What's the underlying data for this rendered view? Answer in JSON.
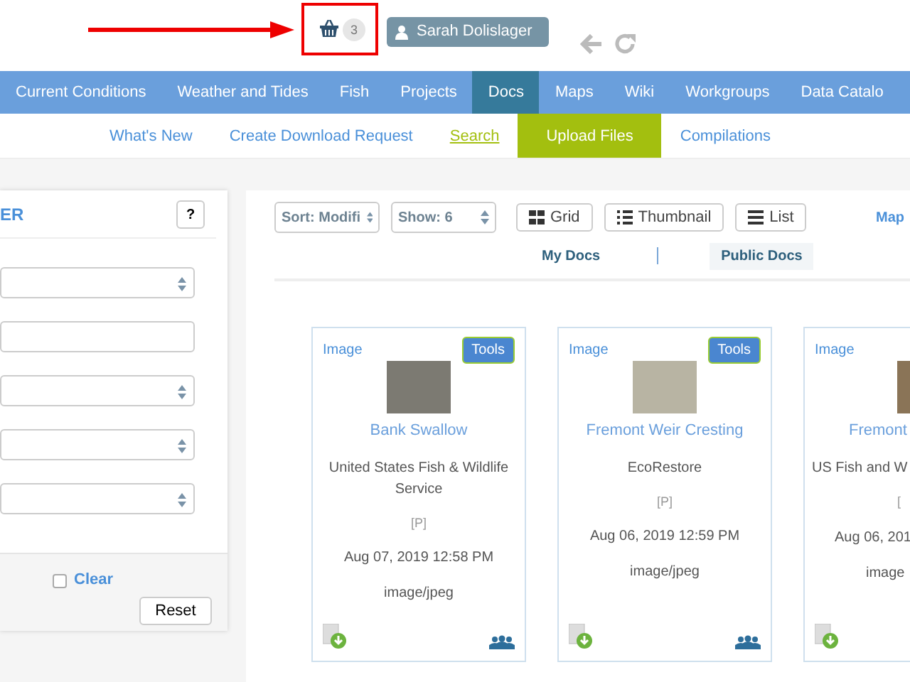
{
  "header": {
    "cart_count": "3",
    "user_name": "Sarah Dolislager"
  },
  "nav": [
    {
      "label": "Current Conditions",
      "selected": false
    },
    {
      "label": "Weather and Tides",
      "selected": false
    },
    {
      "label": "Fish",
      "selected": false
    },
    {
      "label": "Projects",
      "selected": false
    },
    {
      "label": "Docs",
      "selected": true
    },
    {
      "label": "Maps",
      "selected": false
    },
    {
      "label": "Wiki",
      "selected": false
    },
    {
      "label": "Workgroups",
      "selected": false
    },
    {
      "label": "Data Catalo",
      "selected": false
    }
  ],
  "subnav": [
    {
      "label": "What's New",
      "kind": "link",
      "selected": false
    },
    {
      "label": "Create Download Request",
      "kind": "link",
      "selected": false
    },
    {
      "label": "Search",
      "kind": "link",
      "selected": true
    },
    {
      "label": "Upload Files",
      "kind": "button",
      "selected": false
    },
    {
      "label": "Compilations",
      "kind": "link",
      "selected": false
    }
  ],
  "sidebar": {
    "title": "ER",
    "help": "?",
    "fields": [
      {
        "kind": "select"
      },
      {
        "kind": "input"
      },
      {
        "kind": "select"
      },
      {
        "kind": "select"
      },
      {
        "kind": "select"
      }
    ],
    "clear": {
      "label": "Clear",
      "checked": false
    },
    "reset": "Reset"
  },
  "toolbar": {
    "sort": "Sort: Modifi",
    "show": "Show: 6",
    "views": [
      "Grid",
      "Thumbnail",
      "List"
    ],
    "map_link": "Map"
  },
  "scope_tabs": [
    {
      "label": "My Docs",
      "selected": false
    },
    {
      "label": "Public Docs",
      "selected": true
    }
  ],
  "cards": [
    {
      "type": "Image",
      "tools": "Tools",
      "title": "Bank Swallow",
      "org": "United States Fish & Wildlife Service",
      "flag": "[P]",
      "date": "Aug 07, 2019 12:58 PM",
      "mime": "image/jpeg",
      "shared": true
    },
    {
      "type": "Image",
      "tools": "Tools",
      "title": "Fremont Weir Cresting",
      "org": "EcoRestore",
      "flag": "[P]",
      "date": "Aug 06, 2019 12:59 PM",
      "mime": "image/jpeg",
      "shared": true
    },
    {
      "type": "Image",
      "title": "Fremont",
      "org": "US Fish and W",
      "flag": "[",
      "date": "Aug 06, 201",
      "mime": "image",
      "shared": false
    }
  ]
}
